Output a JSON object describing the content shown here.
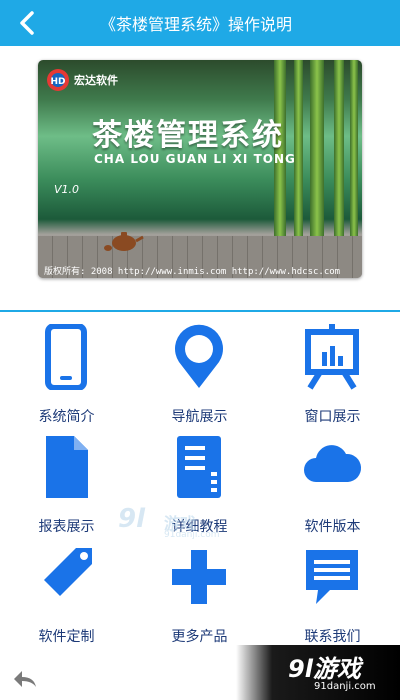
{
  "header": {
    "title": "《茶楼管理系统》操作说明"
  },
  "banner": {
    "brand": "宏达软件",
    "title": "茶楼管理系统",
    "subtitle": "CHA LOU GUAN LI XI TONG",
    "version": "V1.0",
    "copyright": "版权所有: 2008  http://www.inmis.com http://www.hdcsc.com"
  },
  "menu": [
    {
      "label": "系统简介",
      "icon": "phone-icon"
    },
    {
      "label": "导航展示",
      "icon": "location-pin-icon"
    },
    {
      "label": "窗口展示",
      "icon": "presentation-board-icon"
    },
    {
      "label": "报表展示",
      "icon": "document-icon"
    },
    {
      "label": "详细教程",
      "icon": "notebook-icon"
    },
    {
      "label": "软件版本",
      "icon": "cloud-icon"
    },
    {
      "label": "软件定制",
      "icon": "tag-icon"
    },
    {
      "label": "更多产品",
      "icon": "plus-icon"
    },
    {
      "label": "联系我们",
      "icon": "message-icon"
    }
  ],
  "watermark": {
    "brand": "9l游戏",
    "url": "91danji.com",
    "mid_brand": "9l",
    "mid_text": "游戏",
    "mid_url": "91danji.com"
  },
  "colors": {
    "header": "#1fa9e6",
    "icon": "#1a73e8",
    "label": "#1d3a78"
  }
}
